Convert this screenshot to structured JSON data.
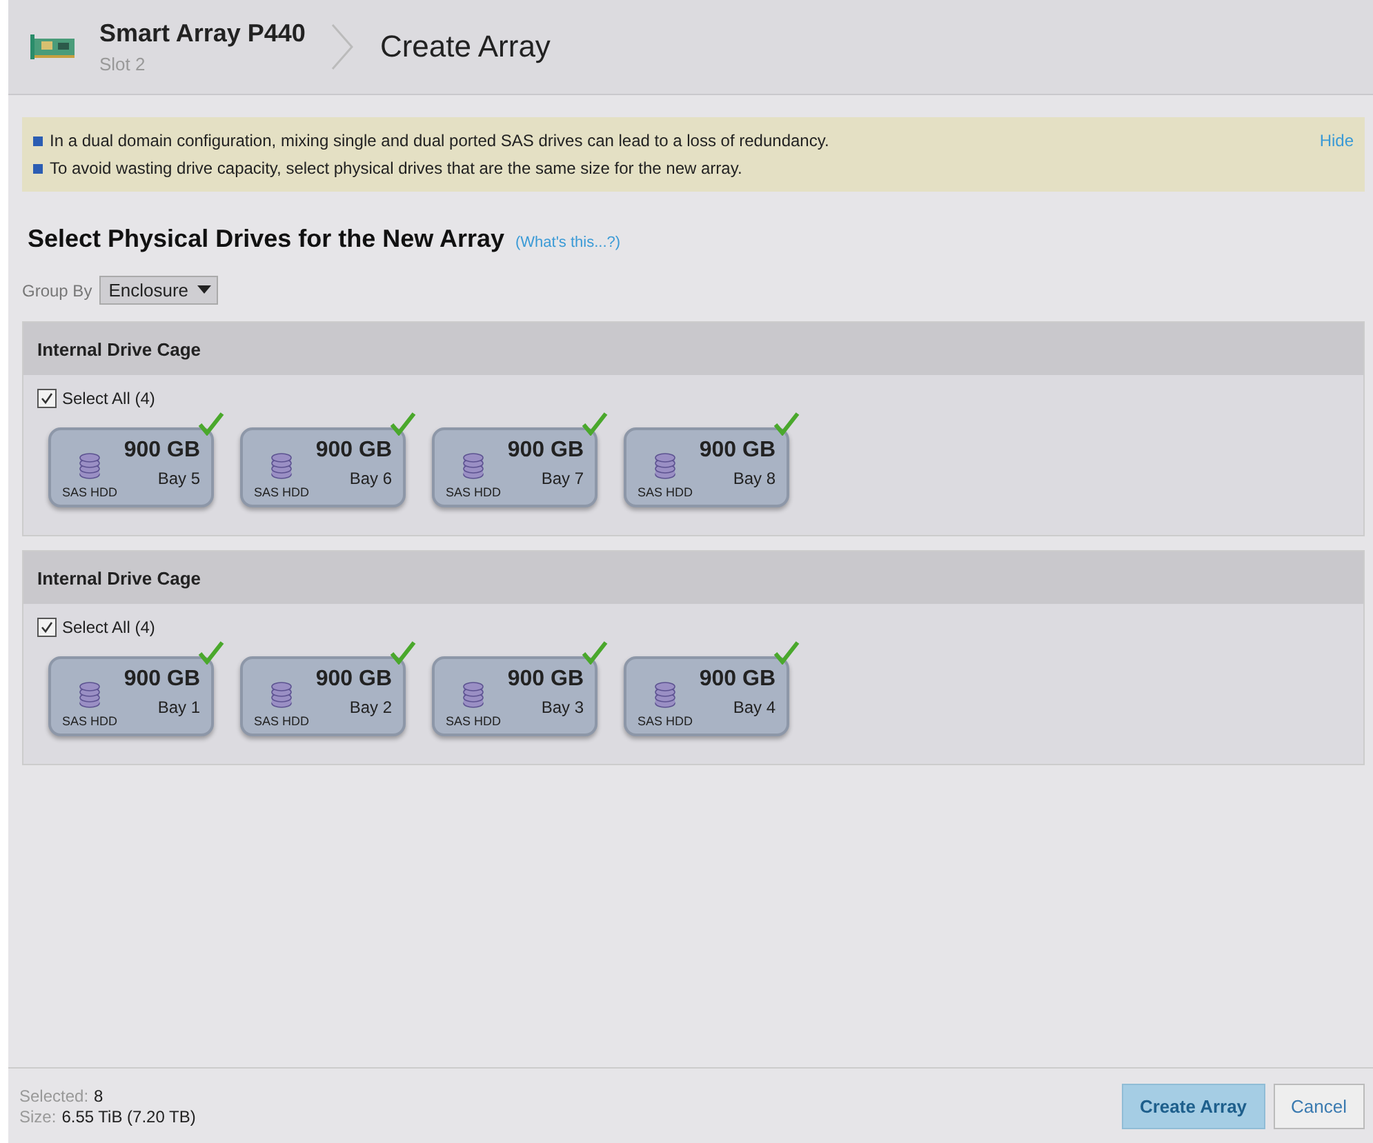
{
  "header": {
    "device": "Smart Array P440",
    "slot": "Slot 2",
    "page_title": "Create Array"
  },
  "notice": {
    "messages": [
      "In a dual domain configuration, mixing single and dual ported SAS drives can lead to a loss of redundancy.",
      "To avoid wasting drive capacity, select physical drives that are the same size for the new array."
    ],
    "hide_link": "Hide"
  },
  "heading": "Select Physical Drives for the New Array",
  "help_link": "(What's this...?)",
  "group_by": {
    "label": "Group By",
    "value": "Enclosure"
  },
  "groups": [
    {
      "title": "Internal Drive Cage",
      "select_all": "Select All (4)",
      "checked": true,
      "drives": [
        {
          "size": "900 GB",
          "type": "SAS HDD",
          "bay": "Bay 5",
          "selected": true
        },
        {
          "size": "900 GB",
          "type": "SAS HDD",
          "bay": "Bay 6",
          "selected": true
        },
        {
          "size": "900 GB",
          "type": "SAS HDD",
          "bay": "Bay 7",
          "selected": true
        },
        {
          "size": "900 GB",
          "type": "SAS HDD",
          "bay": "Bay 8",
          "selected": true
        }
      ]
    },
    {
      "title": "Internal Drive Cage",
      "select_all": "Select All (4)",
      "checked": true,
      "drives": [
        {
          "size": "900 GB",
          "type": "SAS HDD",
          "bay": "Bay 1",
          "selected": true
        },
        {
          "size": "900 GB",
          "type": "SAS HDD",
          "bay": "Bay 2",
          "selected": true
        },
        {
          "size": "900 GB",
          "type": "SAS HDD",
          "bay": "Bay 3",
          "selected": true
        },
        {
          "size": "900 GB",
          "type": "SAS HDD",
          "bay": "Bay 4",
          "selected": true
        }
      ]
    }
  ],
  "footer": {
    "selected_label": "Selected:",
    "selected_value": "8",
    "size_label": "Size:",
    "size_value": "6.55 TiB (7.20 TB)"
  },
  "buttons": [
    {
      "label": "Create Array",
      "kind": "primary"
    },
    {
      "label": "Cancel",
      "kind": "secondary"
    }
  ]
}
